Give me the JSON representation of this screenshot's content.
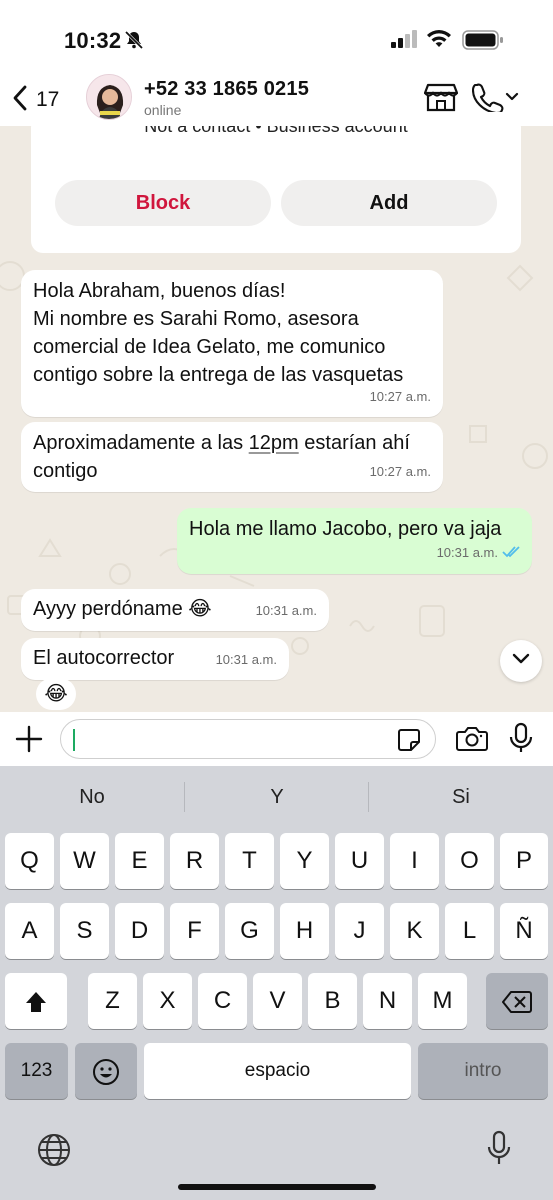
{
  "status_bar": {
    "time": "10:32"
  },
  "header": {
    "back_count": "17",
    "contact_name": "+52 33 1865 0215",
    "contact_status": "online"
  },
  "info_card": {
    "text": "Not a contact • Business account",
    "block_label": "Block",
    "add_label": "Add"
  },
  "messages": [
    {
      "direction": "in",
      "text": "Hola Abraham, buenos días!\nMi nombre es Sarahi Romo, asesora comercial de Idea Gelato, me comunico contigo sobre la entrega de las vasquetas",
      "time": "10:27 a.m."
    },
    {
      "direction": "in",
      "text_before": "Aproximadamente a las ",
      "text_link": "12pm",
      "text_after": " estarían ahí contigo",
      "time": "10:27 a.m."
    },
    {
      "direction": "out",
      "text": "Hola me llamo Jacobo, pero va jaja",
      "time": "10:31 a.m."
    },
    {
      "direction": "in",
      "text": "Ayyy perdóname 😂",
      "time": "10:31 a.m."
    },
    {
      "direction": "in",
      "text": "El autocorrector",
      "time": "10:31 a.m."
    }
  ],
  "reaction": "😂",
  "keyboard": {
    "suggestions": [
      "No",
      "Y",
      "Si"
    ],
    "row1": [
      "Q",
      "W",
      "E",
      "R",
      "T",
      "Y",
      "U",
      "I",
      "O",
      "P"
    ],
    "row2": [
      "A",
      "S",
      "D",
      "F",
      "G",
      "H",
      "J",
      "K",
      "L",
      "Ñ"
    ],
    "row3": [
      "Z",
      "X",
      "C",
      "V",
      "B",
      "N",
      "M"
    ],
    "numbers_label": "123",
    "space_label": "espacio",
    "return_label": "intro"
  },
  "colors": {
    "chat_background": "#efeae2",
    "outgoing_bubble": "#d9fdd3",
    "block_red": "#d0163d",
    "read_ticks": "#53bdeb",
    "keyboard_bg": "#d3d5da"
  },
  "icons": [
    "bell-slash-icon",
    "signal-icon",
    "wifi-icon",
    "battery-icon",
    "chevron-left-icon",
    "store-icon",
    "phone-icon",
    "chevron-down-icon",
    "plus-icon",
    "sticker-icon",
    "camera-icon",
    "microphone-icon",
    "shift-icon",
    "backspace-icon",
    "emoji-icon",
    "globe-icon",
    "double-check-icon"
  ]
}
